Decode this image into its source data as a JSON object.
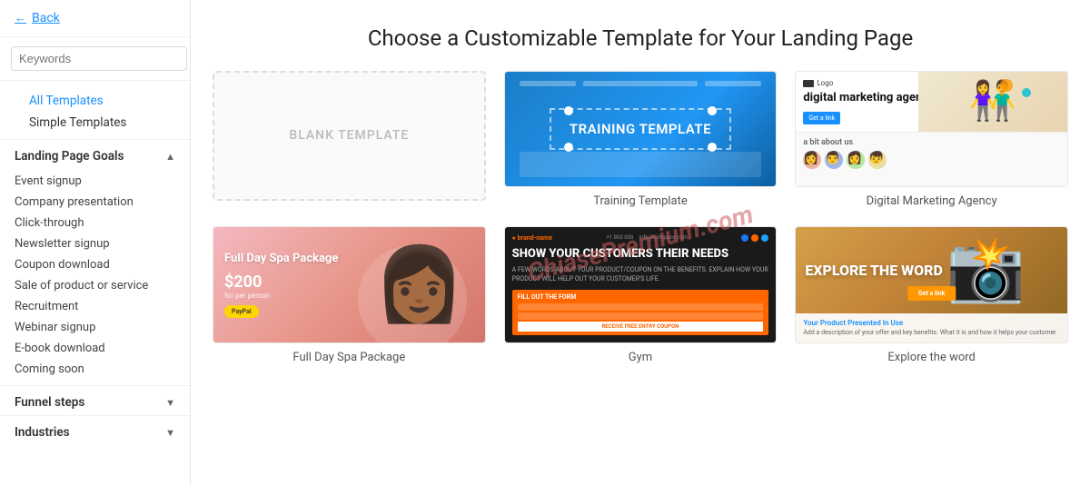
{
  "sidebar": {
    "back_label": "Back",
    "search_placeholder": "Keywords",
    "all_templates_label": "All Templates",
    "simple_templates_label": "Simple Templates",
    "landing_page_goals_label": "Landing Page Goals",
    "items": [
      {
        "id": "event-signup",
        "label": "Event signup"
      },
      {
        "id": "company-presentation",
        "label": "Company presentation"
      },
      {
        "id": "click-through",
        "label": "Click-through"
      },
      {
        "id": "newsletter-signup",
        "label": "Newsletter signup"
      },
      {
        "id": "coupon-download",
        "label": "Coupon download"
      },
      {
        "id": "sale-of-product",
        "label": "Sale of product or service"
      },
      {
        "id": "recruitment",
        "label": "Recruitment"
      },
      {
        "id": "webinar-signup",
        "label": "Webinar signup"
      },
      {
        "id": "ebook-download",
        "label": "E-book download"
      },
      {
        "id": "coming-soon",
        "label": "Coming soon"
      }
    ],
    "funnel_steps_label": "Funnel steps",
    "industries_label": "Industries"
  },
  "main": {
    "page_title": "Choose a Customizable Template for Your Landing Page",
    "templates": [
      {
        "id": "blank",
        "label": ""
      },
      {
        "id": "training",
        "label": "Training Template"
      },
      {
        "id": "dma",
        "label": "Digital Marketing Agency"
      },
      {
        "id": "spa",
        "label": "Full Day Spa Package"
      },
      {
        "id": "gym",
        "label": "Gym"
      },
      {
        "id": "explore",
        "label": "Explore the word"
      }
    ],
    "blank_template_text": "BLANK TEMPLATE",
    "training_template_text": "TRAINING TEMPLATE",
    "dma_heading": "digital marketing agency.",
    "dma_about": "a bit about us",
    "dma_cta": "Get a link",
    "dma_logo_label": "Logo",
    "spa_title": "Full Day Spa Package",
    "spa_price": "$200",
    "spa_price_sub": "for per person",
    "gym_headline": "SHOW YOUR CUSTOMERS THEIR NEEDS",
    "gym_sub": "A FEW WORDS ABOUT YOUR PRODUCT/COUPON ON THE BENEFITS. EXPLAIN HOW YOUR PRODUCT WILL HELP OUT YOUR CUSTOMER'S LIFE.",
    "gym_form_title": "FILL OUT THE FORM",
    "gym_submit": "RECEIVE FREE ENTRY COUPON",
    "explore_title": "EXPLORE THE WORD",
    "explore_product_title": "Your Product Presented In Use",
    "explore_product_sub": "Add a description of your offer and key benefits. What it is and how it helps your customer"
  },
  "watermark": {
    "text": "ChiasePremium.com"
  }
}
